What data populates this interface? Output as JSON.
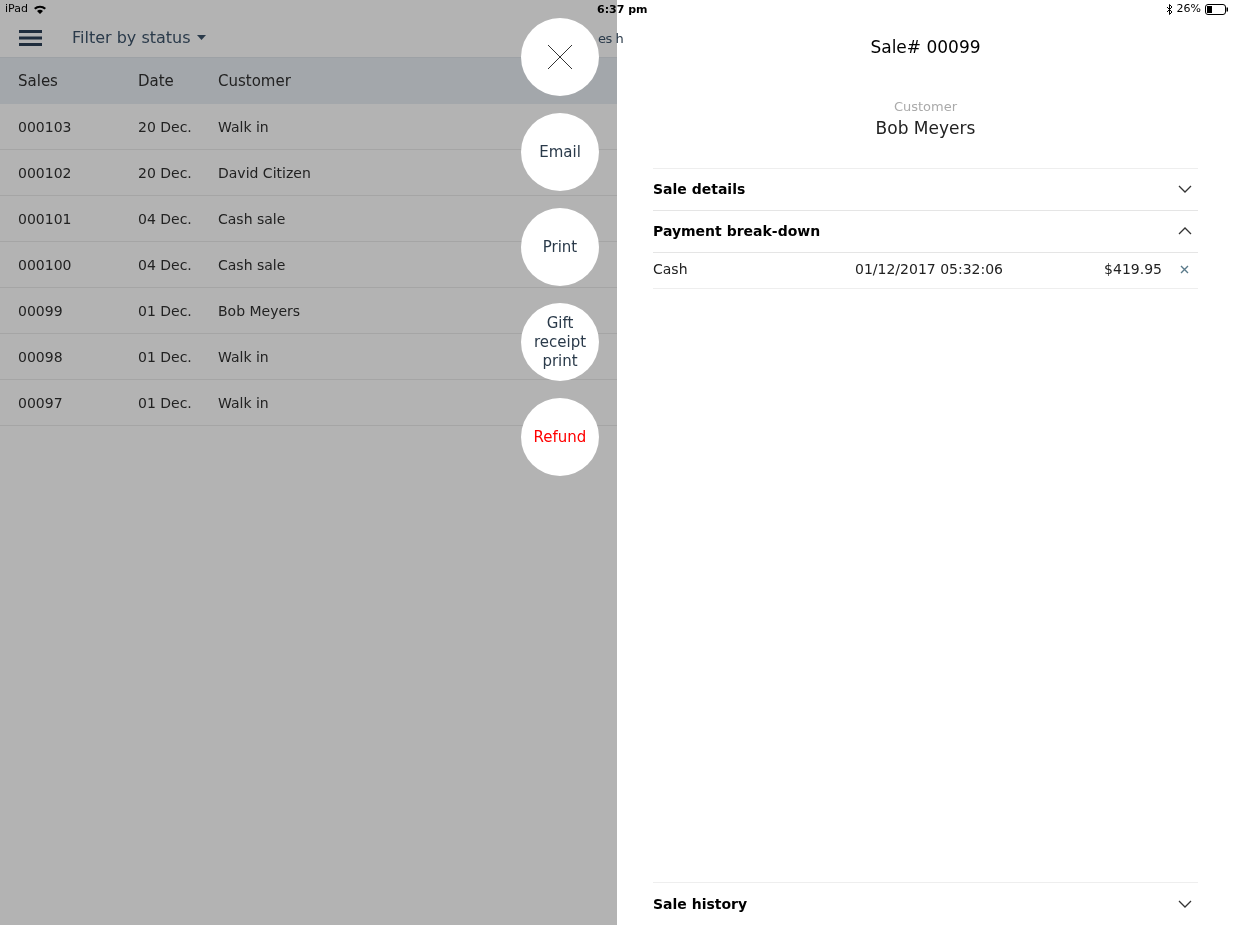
{
  "status_bar": {
    "device": "iPad",
    "time": "6:37 pm",
    "battery": "26%"
  },
  "toolbar": {
    "filter": "Filter by status",
    "title_fragment": "es h"
  },
  "table": {
    "columns": [
      "Sales",
      "Date",
      "Customer"
    ],
    "rows": [
      [
        "000103",
        "20 Dec.",
        "Walk in"
      ],
      [
        "000102",
        "20 Dec.",
        "David Citizen"
      ],
      [
        "000101",
        "04 Dec.",
        "Cash sale"
      ],
      [
        "000100",
        "04 Dec.",
        "Cash sale"
      ],
      [
        "00099",
        "01 Dec.",
        "Bob Meyers"
      ],
      [
        "00098",
        "01 Dec.",
        "Walk in"
      ],
      [
        "00097",
        "01 Dec.",
        "Walk in"
      ]
    ]
  },
  "actions": [
    {
      "kind": "close"
    },
    {
      "kind": "text",
      "label": "Email"
    },
    {
      "kind": "text",
      "label": "Print"
    },
    {
      "kind": "text",
      "label": "Gift receipt print"
    },
    {
      "kind": "danger",
      "label": "Refund"
    }
  ],
  "detail": {
    "title": "Sale# 00099",
    "customer_label": "Customer",
    "customer": "Bob Meyers",
    "sections": [
      {
        "title": "Sale details",
        "expanded": false
      },
      {
        "title": "Payment break-down",
        "expanded": true,
        "payments": [
          {
            "method": "Cash",
            "date": "01/12/2017 05:32:06",
            "amount": "$419.95"
          }
        ]
      }
    ],
    "footer_section": {
      "title": "Sale history",
      "expanded": false
    }
  }
}
